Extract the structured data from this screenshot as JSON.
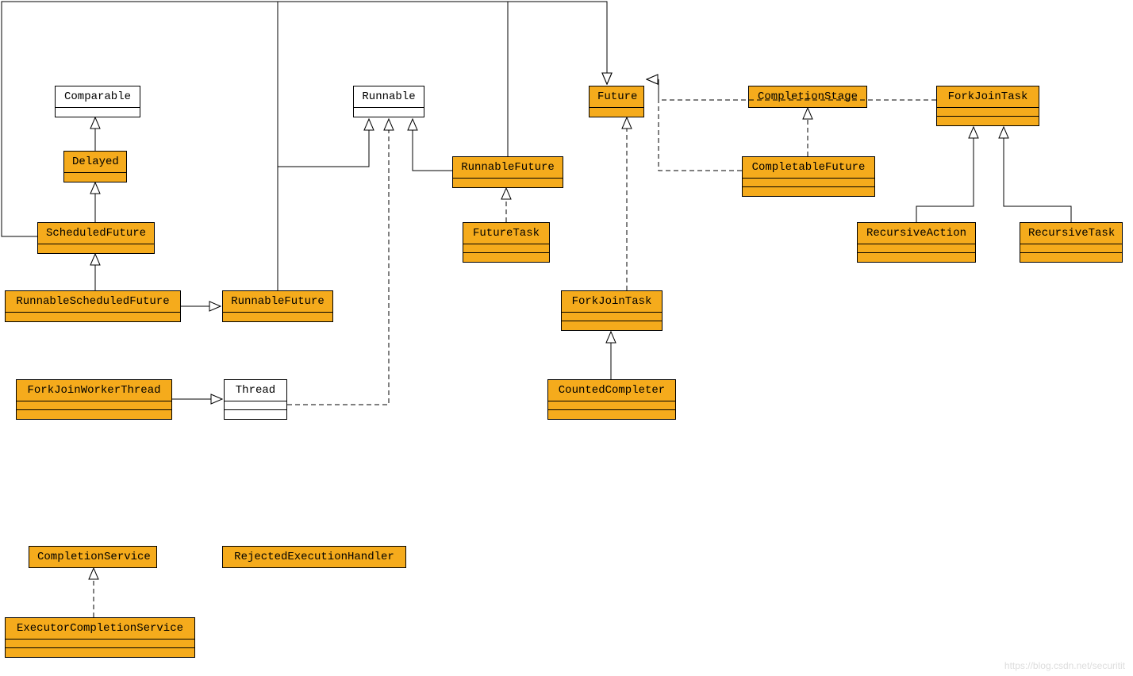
{
  "chart_data": {
    "type": "diagram",
    "title": "Java Concurrency Class Hierarchy (UML)",
    "nodes": [
      {
        "id": "Comparable",
        "stereotype": "interface",
        "color": "white"
      },
      {
        "id": "Runnable",
        "stereotype": "interface",
        "color": "white"
      },
      {
        "id": "Thread",
        "stereotype": "class",
        "color": "white"
      },
      {
        "id": "Future",
        "stereotype": "interface",
        "color": "orange"
      },
      {
        "id": "CompletionStage",
        "stereotype": "interface",
        "color": "orange"
      },
      {
        "id": "ForkJoinTask_top",
        "label": "ForkJoinTask",
        "stereotype": "class",
        "color": "orange"
      },
      {
        "id": "Delayed",
        "stereotype": "interface",
        "color": "orange"
      },
      {
        "id": "ScheduledFuture",
        "stereotype": "interface",
        "color": "orange"
      },
      {
        "id": "RunnableScheduledFuture",
        "stereotype": "interface",
        "color": "orange"
      },
      {
        "id": "RunnableFuture_left",
        "label": "RunnableFuture",
        "stereotype": "interface",
        "color": "orange"
      },
      {
        "id": "RunnableFuture_mid",
        "label": "RunnableFuture",
        "stereotype": "interface",
        "color": "orange"
      },
      {
        "id": "FutureTask",
        "stereotype": "class",
        "color": "orange"
      },
      {
        "id": "CompletableFuture",
        "stereotype": "class",
        "color": "orange"
      },
      {
        "id": "RecursiveAction",
        "stereotype": "class",
        "color": "orange"
      },
      {
        "id": "RecursiveTask",
        "stereotype": "class",
        "color": "orange"
      },
      {
        "id": "ForkJoinTask_mid",
        "label": "ForkJoinTask",
        "stereotype": "class",
        "color": "orange"
      },
      {
        "id": "CountedCompleter",
        "stereotype": "class",
        "color": "orange"
      },
      {
        "id": "ForkJoinWorkerThread",
        "stereotype": "class",
        "color": "orange"
      },
      {
        "id": "CompletionService",
        "stereotype": "interface",
        "color": "orange"
      },
      {
        "id": "ExecutorCompletionService",
        "stereotype": "class",
        "color": "orange"
      },
      {
        "id": "RejectedExecutionHandler",
        "stereotype": "interface",
        "color": "orange"
      }
    ],
    "edges": [
      {
        "from": "Delayed",
        "to": "Comparable",
        "type": "generalization"
      },
      {
        "from": "ScheduledFuture",
        "to": "Delayed",
        "type": "generalization"
      },
      {
        "from": "ScheduledFuture",
        "to": "Future",
        "type": "generalization"
      },
      {
        "from": "RunnableScheduledFuture",
        "to": "ScheduledFuture",
        "type": "generalization"
      },
      {
        "from": "RunnableScheduledFuture",
        "to": "RunnableFuture_left",
        "type": "generalization"
      },
      {
        "from": "RunnableFuture_left",
        "to": "Runnable",
        "type": "generalization"
      },
      {
        "from": "RunnableFuture_left",
        "to": "Future",
        "type": "generalization"
      },
      {
        "from": "RunnableFuture_mid",
        "to": "Runnable",
        "type": "generalization"
      },
      {
        "from": "RunnableFuture_mid",
        "to": "Future",
        "type": "generalization"
      },
      {
        "from": "FutureTask",
        "to": "RunnableFuture_mid",
        "type": "realization"
      },
      {
        "from": "ForkJoinTask_mid",
        "to": "Future",
        "type": "realization"
      },
      {
        "from": "CountedCompleter",
        "to": "ForkJoinTask_mid",
        "type": "generalization"
      },
      {
        "from": "CompletableFuture",
        "to": "Future",
        "type": "realization"
      },
      {
        "from": "CompletableFuture",
        "to": "CompletionStage",
        "type": "realization"
      },
      {
        "from": "ForkJoinTask_top",
        "to": "Future",
        "type": "realization"
      },
      {
        "from": "RecursiveAction",
        "to": "ForkJoinTask_top",
        "type": "generalization"
      },
      {
        "from": "RecursiveTask",
        "to": "ForkJoinTask_top",
        "type": "generalization"
      },
      {
        "from": "ForkJoinWorkerThread",
        "to": "Thread",
        "type": "generalization"
      },
      {
        "from": "Thread",
        "to": "Runnable",
        "type": "realization"
      },
      {
        "from": "ExecutorCompletionService",
        "to": "CompletionService",
        "type": "realization"
      }
    ]
  },
  "boxes": {
    "comparable": "Comparable",
    "runnable": "Runnable",
    "future": "Future",
    "completionstage": "CompletionStage",
    "forkjointask_top": "ForkJoinTask",
    "delayed": "Delayed",
    "scheduledfuture": "ScheduledFuture",
    "runnablescheduledfuture": "RunnableScheduledFuture",
    "runnablefuture_left": "RunnableFuture",
    "runnablefuture_mid": "RunnableFuture",
    "futuretask": "FutureTask",
    "completablefuture": "CompletableFuture",
    "recursiveaction": "RecursiveAction",
    "recursivetask": "RecursiveTask",
    "forkjointask_mid": "ForkJoinTask",
    "countedcompleter": "CountedCompleter",
    "forkjoinworkerthread": "ForkJoinWorkerThread",
    "thread": "Thread",
    "completionservice": "CompletionService",
    "executorcompletionservice": "ExecutorCompletionService",
    "rejectedexecutionhandler": "RejectedExecutionHandler"
  },
  "watermark": "https://blog.csdn.net/securitit"
}
